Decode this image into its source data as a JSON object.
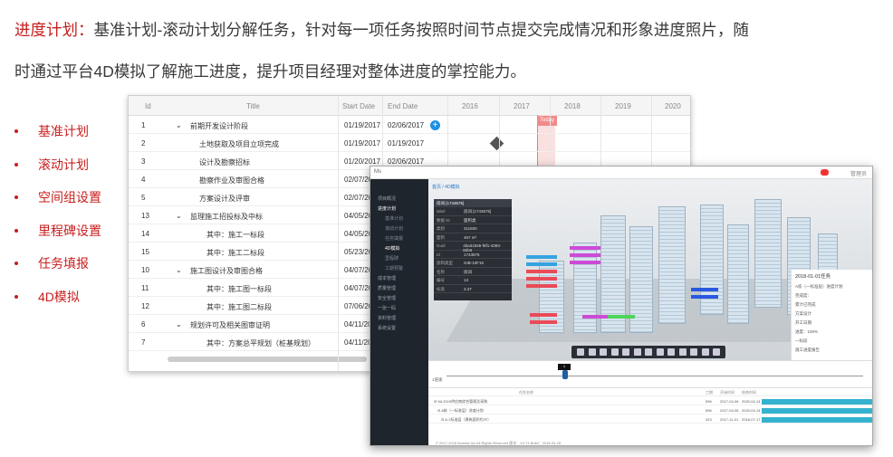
{
  "headline": {
    "key": "进度计划",
    "colon": "：",
    "line1_rest": "基准计划-滚动计划分解任务，针对每一项任务按照时间节点提交完成情况和形象进度照片，随",
    "line2": "时通过平台4D模拟了解施工进度，提升项目经理对整体进度的掌控能力。"
  },
  "bullets": [
    "基准计划",
    "滚动计划",
    "空间组设置",
    "里程碑设置",
    "任务填报",
    "4D模拟"
  ],
  "gantt": {
    "columns": {
      "id": "Id",
      "title": "Title",
      "start": "Start Date",
      "end": "End Date"
    },
    "years": [
      "2016",
      "2017",
      "2018",
      "2019",
      "2020"
    ],
    "today_label": "Today",
    "rows": [
      {
        "id": "1",
        "title": "前期开发设计阶段",
        "start": "01/19/2017",
        "end": "02/06/2017",
        "toggle": "⌄",
        "indent": 0
      },
      {
        "id": "2",
        "title": "土地获取及项目立项完成",
        "start": "01/19/2017",
        "end": "01/19/2017",
        "toggle": "",
        "indent": 1
      },
      {
        "id": "3",
        "title": "设计及勘察招标",
        "start": "01/20/2017",
        "end": "02/06/2017",
        "toggle": "",
        "indent": 1
      },
      {
        "id": "4",
        "title": "勘察作业及审图合格",
        "start": "02/07/20",
        "end": "",
        "toggle": "",
        "indent": 1
      },
      {
        "id": "5",
        "title": "方案设计及评审",
        "start": "02/07/20",
        "end": "",
        "toggle": "",
        "indent": 1
      },
      {
        "id": "13",
        "title": "监理施工招投标及中标",
        "start": "04/05/20",
        "end": "",
        "toggle": "⌄",
        "indent": 0
      },
      {
        "id": "14",
        "title": "其中：施工一标段",
        "start": "04/05/20",
        "end": "",
        "toggle": "",
        "indent": 2
      },
      {
        "id": "15",
        "title": "其中：施工二标段",
        "start": "05/23/20",
        "end": "",
        "toggle": "",
        "indent": 2
      },
      {
        "id": "10",
        "title": "施工图设计及审图合格",
        "start": "04/07/20",
        "end": "",
        "toggle": "⌄",
        "indent": 0
      },
      {
        "id": "11",
        "title": "其中：施工图一标段",
        "start": "04/07/20",
        "end": "",
        "toggle": "",
        "indent": 2
      },
      {
        "id": "12",
        "title": "其中：施工图二标段",
        "start": "07/06/20",
        "end": "",
        "toggle": "",
        "indent": 2
      },
      {
        "id": "6",
        "title": "规划许可及相关图审证明",
        "start": "04/11/20",
        "end": "",
        "toggle": "⌄",
        "indent": 0
      },
      {
        "id": "7",
        "title": "其中：方案总平规划（桩基规划）",
        "start": "04/11/20",
        "end": "",
        "toggle": "",
        "indent": 2
      }
    ]
  },
  "app": {
    "logo": "Ms",
    "user": "管理员",
    "breadcrumb": "首页 / 4D模拟",
    "sidebar": [
      {
        "label": "项目概况",
        "sub": false,
        "active": false
      },
      {
        "label": "进度计划",
        "sub": false,
        "active": true
      },
      {
        "label": "基准计划",
        "sub": true,
        "active": false
      },
      {
        "label": "滚动计划",
        "sub": true,
        "active": false
      },
      {
        "label": "任务填报",
        "sub": true,
        "active": false
      },
      {
        "label": "4D模拟",
        "sub": true,
        "active": true
      },
      {
        "label": "里程碑",
        "sub": true,
        "active": false
      },
      {
        "label": "工期预警",
        "sub": true,
        "active": false
      },
      {
        "label": "成本管理",
        "sub": false,
        "active": false
      },
      {
        "label": "质量管理",
        "sub": false,
        "active": false
      },
      {
        "label": "安全管理",
        "sub": false,
        "active": false
      },
      {
        "label": "一张一码",
        "sub": false,
        "active": false
      },
      {
        "label": "资料管理",
        "sub": false,
        "active": false
      },
      {
        "label": "系统设置",
        "sub": false,
        "active": false
      }
    ],
    "properties": {
      "title": "房间 [1743675]",
      "rows": [
        {
          "k": "label",
          "v": "房间 [1743675]"
        },
        {
          "k": "数据 ID",
          "v": "面积类"
        },
        {
          "k": "类别",
          "v": "311600"
        },
        {
          "k": "面积",
          "v": "467 m²"
        },
        {
          "k": "Guid",
          "v": "4ba31b65-f6f1-4393-82b6"
        },
        {
          "k": "Id",
          "v": "1743675"
        },
        {
          "k": "族和类型",
          "v": "GIB-10F16"
        },
        {
          "k": "名称",
          "v": "房间"
        },
        {
          "k": "编号",
          "v": "13"
        },
        {
          "k": "标高",
          "v": "3.37"
        }
      ]
    },
    "right_panel": {
      "date": "2018-01-01任务",
      "lines": [
        "A栋（一标准层）进度计划",
        "完成度：",
        "累计已完成",
        "方案设计",
        "开工日期",
        "进度：100%",
        "一标段",
        "施工进度报告"
      ]
    },
    "timeline": {
      "tag": "1",
      "speed": "1倍速"
    },
    "tasks": {
      "headers": {
        "name": "任务名称",
        "duration": "工期",
        "start": "开始时间",
        "end": "结束时间"
      },
      "rows": [
        {
          "name": "⊟ 6A 2019供应商综合管理及采购",
          "duration": "596",
          "start": "2017-04-06",
          "end": "2020-04-14"
        },
        {
          "name": "⊟ A栋（一标准层）进度计划",
          "duration": "596",
          "start": "2017-04-06",
          "end": "2020-04-14"
        },
        {
          "name": "⊟ A-1标准层（建筑面积约2F）",
          "duration": "423",
          "start": "2017-11-01",
          "end": "2018-07-17"
        }
      ]
    },
    "footer": "© 2017-2018 Avanda Inc All Rights Reserved   版本：V3.74   Build：2018-04-28"
  }
}
